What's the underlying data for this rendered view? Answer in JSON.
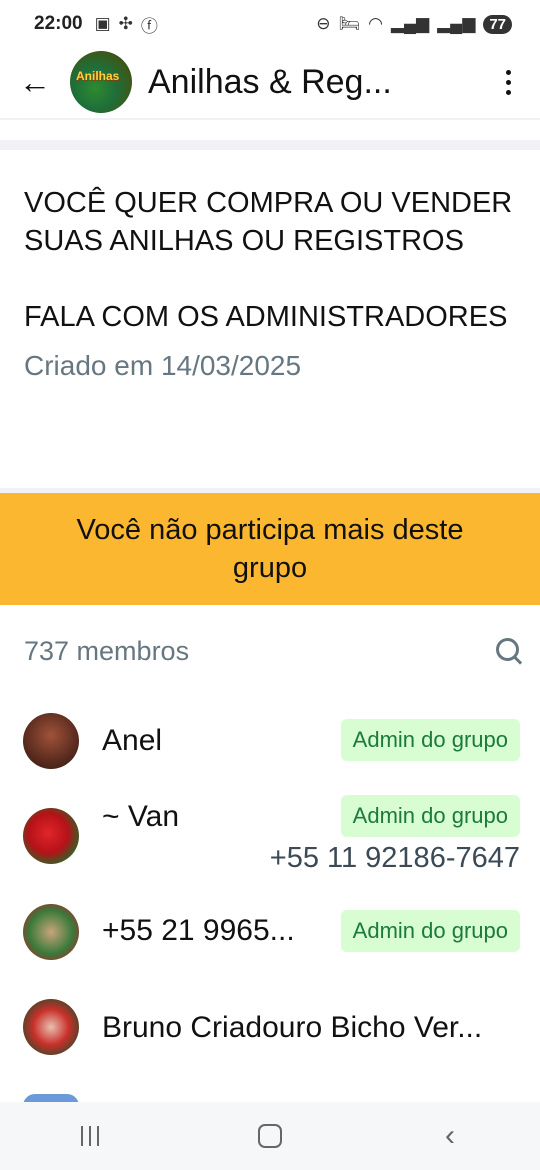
{
  "status_bar": {
    "time": "22:00",
    "battery": "77",
    "left_icons": [
      "screenshot-icon",
      "pinwheel-icon",
      "facebook-icon"
    ],
    "right_icons": [
      "do-not-disturb-icon",
      "bed-icon",
      "wifi-icon",
      "signal-icon",
      "signal-icon-2"
    ]
  },
  "app_bar": {
    "title": "Anilhas & Reg...",
    "avatar_logo_text": "Anilhas"
  },
  "description": {
    "text": "VOCÊ QUER COMPRA OU VENDER SUAS ANILHAS OU REGISTROS\n\nFALA COM OS ADMINISTRADORES",
    "created": "Criado em 14/03/2025"
  },
  "banner": {
    "text": "Você não participa mais deste grupo",
    "color": "#fcb731"
  },
  "members": {
    "count_label": "737 membros",
    "list": [
      {
        "name": "Anel",
        "badge": "Admin do grupo",
        "phone": ""
      },
      {
        "name": "~ Van",
        "badge": "Admin do grupo",
        "phone": "+55 11 92186-7647"
      },
      {
        "name": "+55 21 9965...",
        "badge": "Admin do grupo",
        "phone": ""
      },
      {
        "name": "Bruno Criadouro Bicho Ver...",
        "badge": "",
        "phone": ""
      }
    ]
  },
  "colors": {
    "accent_badge_bg": "#d9fdd3",
    "accent_badge_text": "#1b7a3c"
  }
}
